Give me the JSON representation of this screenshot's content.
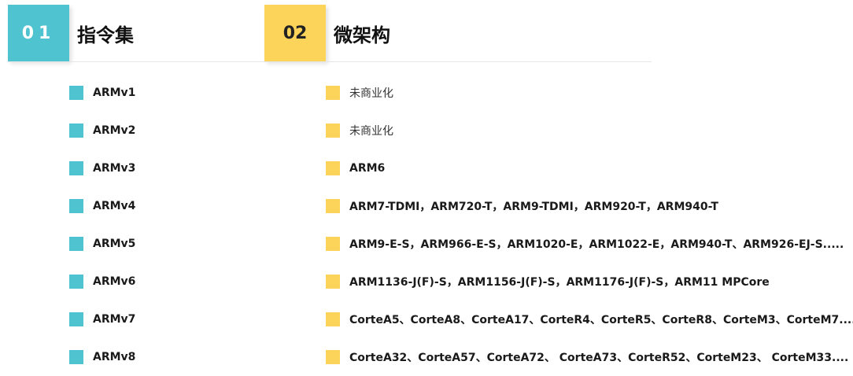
{
  "section1": {
    "number": "01",
    "title": "指令集",
    "accent": "#4fc3d0"
  },
  "section2": {
    "number": "02",
    "title": "微架构",
    "accent": "#fdd45a"
  },
  "instruction_sets": [
    "ARMv1",
    "ARMv2",
    "ARMv3",
    "ARMv4",
    "ARMv5",
    "ARMv6",
    "ARMv7",
    "ARMv8"
  ],
  "microarchitectures": [
    "未商业化",
    "未商业化",
    "ARM6",
    "ARM7-TDMI，ARM720-T，ARM9-TDMI，ARM920-T，ARM940-T",
    "ARM9-E-S，ARM966-E-S，ARM1020-E，ARM1022-E，ARM940-T、ARM926-EJ-S.....",
    "ARM1136-J(F)-S，ARM1156-J(F)-S，ARM1176-J(F)-S，ARM11 MPCore",
    "CorteA5、CorteA8、CorteA17、CorteR4、CorteR5、CorteR8、CorteM3、CorteM7....",
    "CorteA32、CorteA57、CorteA72、 CorteA73、CorteR52、CorteM23、 CorteM33...."
  ]
}
